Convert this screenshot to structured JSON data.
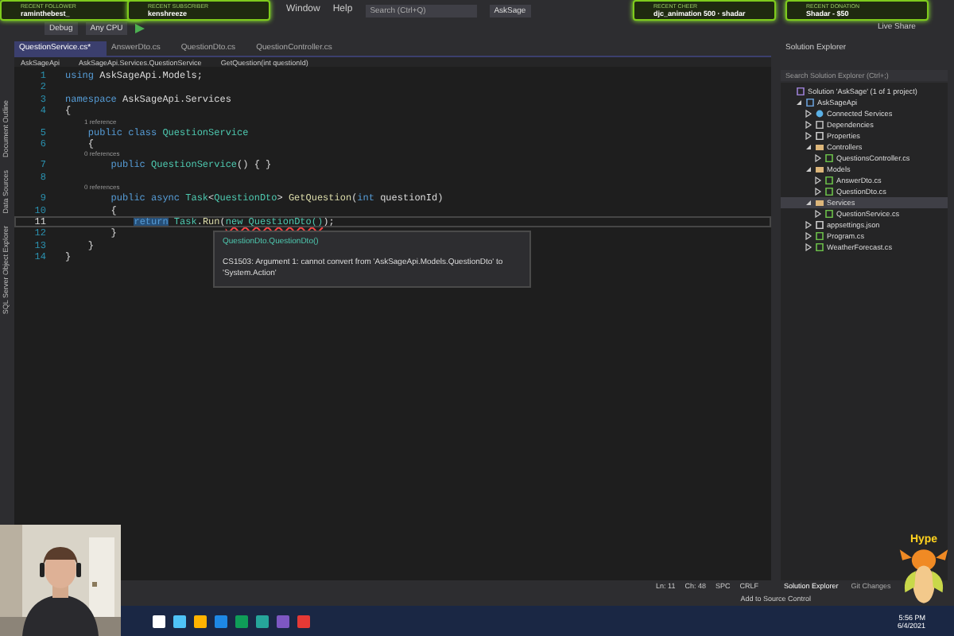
{
  "overlays": [
    {
      "label": "RECENT FOLLOWER",
      "value": "raminthebest_"
    },
    {
      "label": "RECENT SUBSCRIBER",
      "value": "kenshreeze"
    },
    {
      "label": "RECENT CHEER",
      "value": "djc_animation 500 · shadar"
    },
    {
      "label": "RECENT DONATION",
      "value": "Shadar - $50"
    }
  ],
  "menu": [
    "Window",
    "Help"
  ],
  "search": {
    "placeholder": "Search (Ctrl+Q)"
  },
  "solution_button": "AskSage",
  "toolbar": {
    "configuration": "Debug",
    "platform": "Any CPU"
  },
  "live_share": "Live Share",
  "tabs": [
    {
      "label": "QuestionService.cs*",
      "selected": true
    },
    {
      "label": "AnswerDto.cs",
      "selected": false
    },
    {
      "label": "QuestionDto.cs",
      "selected": false
    },
    {
      "label": "QuestionController.cs",
      "selected": false
    }
  ],
  "nav": [
    "AskSageApi",
    "AskSageApi.Services.QuestionService",
    "GetQuestion(int questionId)"
  ],
  "side_tabs": [
    "Document Outline",
    "Data Sources",
    "SQL Server Object Explorer"
  ],
  "code": [
    {
      "kind": "line",
      "number": "1",
      "current": false,
      "tokens": [
        {
          "kind": "kw",
          "text": "using"
        },
        {
          "kind": "plain",
          "text": " AskSageApi.Models;"
        }
      ]
    },
    {
      "kind": "line",
      "number": "2",
      "current": false
    },
    {
      "kind": "line",
      "number": "3",
      "current": false,
      "tokens": [
        {
          "kind": "kw",
          "text": "namespace"
        },
        {
          "kind": "plain",
          "text": " AskSageApi.Services"
        }
      ]
    },
    {
      "kind": "line",
      "number": "4",
      "current": false,
      "tokens": [
        {
          "kind": "plain",
          "text": "{"
        }
      ]
    },
    {
      "kind": "lens",
      "text": "1 reference"
    },
    {
      "kind": "line",
      "number": "5",
      "current": false,
      "tokens": [
        {
          "kind": "kw",
          "text": "    public class"
        },
        {
          "kind": "type",
          "text": " QuestionService"
        }
      ]
    },
    {
      "kind": "line",
      "number": "6",
      "current": false,
      "tokens": [
        {
          "kind": "plain",
          "text": "    {"
        }
      ]
    },
    {
      "kind": "lens",
      "text": "0 references"
    },
    {
      "kind": "line",
      "number": "7",
      "current": false,
      "tokens": [
        {
          "kind": "kw",
          "text": "        public"
        },
        {
          "kind": "type",
          "text": " QuestionService"
        },
        {
          "kind": "plain",
          "text": "() { }"
        }
      ]
    },
    {
      "kind": "line",
      "number": "8",
      "current": false
    },
    {
      "kind": "lens",
      "text": "0 references"
    },
    {
      "kind": "line",
      "number": "9",
      "current": false,
      "tokens": [
        {
          "kind": "kw",
          "text": "        public async"
        },
        {
          "kind": "type",
          "text": " Task"
        },
        {
          "kind": "plain",
          "text": "<"
        },
        {
          "kind": "type",
          "text": "QuestionDto"
        },
        {
          "kind": "plain",
          "text": "> "
        },
        {
          "kind": "method",
          "text": "GetQuestion"
        },
        {
          "kind": "plain",
          "text": "("
        },
        {
          "kind": "kw",
          "text": "int"
        },
        {
          "kind": "plain",
          "text": " questionId)"
        }
      ]
    },
    {
      "kind": "line",
      "number": "10",
      "current": false,
      "tokens": [
        {
          "kind": "plain",
          "text": "        {"
        }
      ]
    },
    {
      "kind": "line",
      "number": "11",
      "current": true,
      "tokens": [
        {
          "kind": "kwmark",
          "text": "            return"
        },
        {
          "kind": "type",
          "text": " Task"
        },
        {
          "kind": "plain",
          "text": "."
        },
        {
          "kind": "method",
          "text": "Run"
        },
        {
          "kind": "plain",
          "text": "("
        },
        {
          "kind": "error",
          "text": "new QuestionDto()"
        },
        {
          "kind": "plain",
          "text": ");"
        }
      ]
    },
    {
      "kind": "line",
      "number": "12",
      "current": false,
      "tokens": [
        {
          "kind": "plain",
          "text": "        }"
        }
      ]
    },
    {
      "kind": "line",
      "number": "13",
      "current": false,
      "tokens": [
        {
          "kind": "plain",
          "text": "    }"
        }
      ]
    },
    {
      "kind": "line",
      "number": "14",
      "current": false,
      "tokens": [
        {
          "kind": "plain",
          "text": "}"
        }
      ]
    }
  ],
  "tooltip": {
    "signature": "QuestionDto.QuestionDto()",
    "code": "CS1503:",
    "message": "Argument 1: cannot convert from 'AskSageApi.Models.QuestionDto' to 'System.Action'"
  },
  "solution_explorer": {
    "title": "Solution Explorer",
    "search": {
      "placeholder": "Search Solution Explorer (Ctrl+;)"
    },
    "items": [
      {
        "kind": "solution",
        "label": "Solution 'AskSage' (1 of 1 project)",
        "selected": false,
        "children": [
          {
            "kind": "project",
            "label": "AskSageApi",
            "selected": false,
            "expanded": true,
            "children": [
              {
                "kind": "connected",
                "label": "Connected Services",
                "selected": false,
                "expanded": false
              },
              {
                "kind": "deps",
                "label": "Dependencies",
                "selected": false,
                "expanded": false
              },
              {
                "kind": "props",
                "label": "Properties",
                "selected": false,
                "expanded": false
              },
              {
                "kind": "folder",
                "label": "Controllers",
                "selected": false,
                "expanded": true,
                "children": [
                  {
                    "kind": "cs",
                    "label": "QuestionsController.cs",
                    "selected": false,
                    "expanded": false
                  }
                ]
              },
              {
                "kind": "folder",
                "label": "Models",
                "selected": false,
                "expanded": true,
                "children": [
                  {
                    "kind": "cs",
                    "label": "AnswerDto.cs",
                    "selected": false,
                    "expanded": false
                  },
                  {
                    "kind": "cs",
                    "label": "QuestionDto.cs",
                    "selected": false,
                    "expanded": false
                  }
                ]
              },
              {
                "kind": "folder",
                "label": "Services",
                "selected": true,
                "expanded": true,
                "children": [
                  {
                    "kind": "cs",
                    "label": "QuestionService.cs",
                    "selected": false,
                    "expanded": false
                  }
                ]
              },
              {
                "kind": "json",
                "label": "appsettings.json",
                "selected": false,
                "expanded": false
              },
              {
                "kind": "cs",
                "label": "Program.cs",
                "selected": false,
                "expanded": false
              },
              {
                "kind": "cs",
                "label": "WeatherForecast.cs",
                "selected": false,
                "expanded": false
              }
            ]
          }
        ]
      }
    ]
  },
  "editor_status": [
    "Ln: 11",
    "Ch: 48",
    "SPC",
    "CRLF"
  ],
  "panel_tabs": [
    {
      "label": "Solution Explorer",
      "selected": true
    },
    {
      "label": "Git Changes",
      "selected": false
    }
  ],
  "status_bar": {
    "source_control": "Add to Source Control"
  },
  "taskbar": {
    "time": "5:56 PM",
    "date": "6/4/2021"
  },
  "mascot": {
    "label": "Hype"
  },
  "webcam": {
    "kind": "picture"
  }
}
